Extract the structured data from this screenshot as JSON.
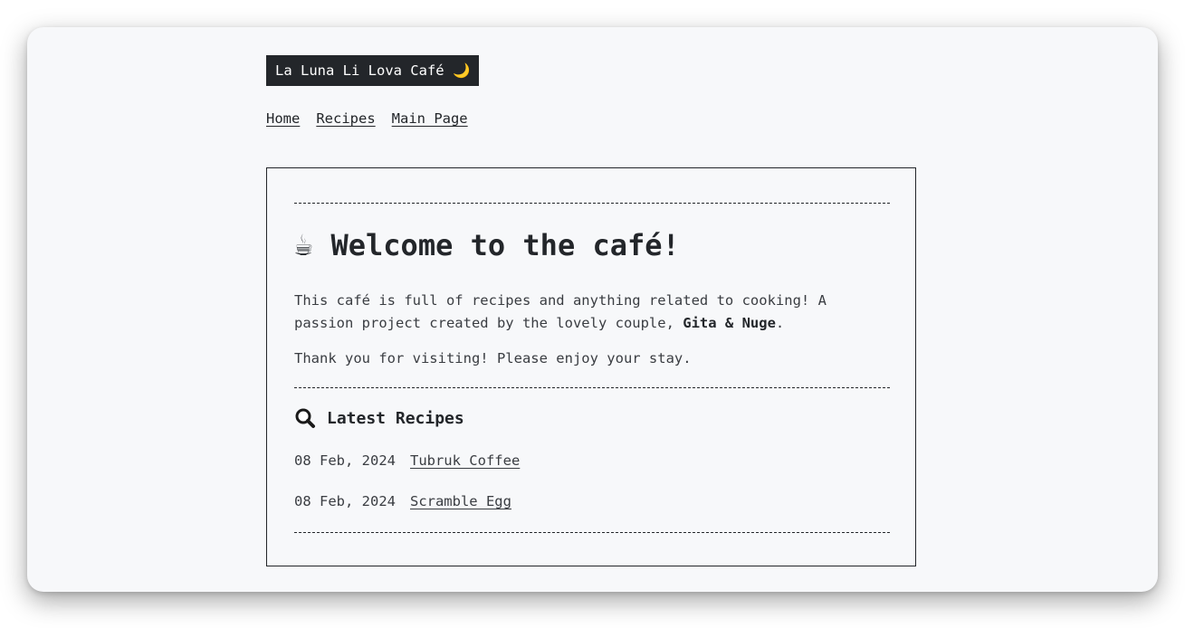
{
  "site": {
    "title": "La Luna Li Lova Café 🌙"
  },
  "nav": {
    "items": [
      {
        "label": "Home"
      },
      {
        "label": "Recipes"
      },
      {
        "label": "Main Page"
      }
    ]
  },
  "welcome": {
    "icon": "coffee-cup-icon",
    "cup_glyph": "☕",
    "heading": "Welcome to the café!",
    "intro_text": "This café is full of recipes and anything related to cooking! A passion project created by the lovely couple, ",
    "couple": "Gita & Nuge",
    "intro_end": ".",
    "thanks": "Thank you for visiting! Please enjoy your stay."
  },
  "latest": {
    "icon": "magnifier-icon",
    "heading": "Latest Recipes",
    "items": [
      {
        "date": "08 Feb, 2024",
        "title": "Tubruk Coffee"
      },
      {
        "date": "08 Feb, 2024",
        "title": "Scramble Egg"
      }
    ]
  },
  "colors": {
    "background": "#f7f8fa",
    "ink": "#23262a",
    "title_bar": "#23262a"
  }
}
